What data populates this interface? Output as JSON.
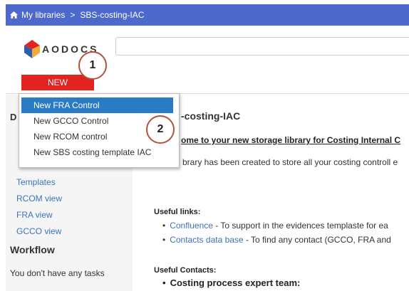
{
  "breadcrumb": {
    "home_label": "My libraries",
    "separator": ">",
    "current": "SBS-costing-IAC"
  },
  "header": {
    "logo_text": "AODOCS",
    "new_button": "NEW"
  },
  "callouts": [
    "1",
    "2"
  ],
  "new_menu": {
    "items": [
      "New FRA Control",
      "New GCCO Control",
      "New RCOM control",
      "New SBS costing template IAC"
    ],
    "active_index": 0
  },
  "sidebar": {
    "partial_heading": "D",
    "links": [
      "Templates",
      "RCOM view",
      "FRA view",
      "GCCO view"
    ],
    "workflow_heading": "Workflow",
    "workflow_note": "You don't have any tasks"
  },
  "main": {
    "title_partial": "-costing-IAC",
    "welcome_partial": "ome to your new storage library for Costing Internal C",
    "description_partial": "brary has been created to store all your costing controll e",
    "useful_links_title": "Useful links:",
    "useful_links": [
      {
        "link": "Confluence",
        "text": " - To support in the evidences templaste for ea"
      },
      {
        "link": "Contacts data base",
        "text": " - To find any contact (GCCO, FRA and"
      }
    ],
    "useful_contacts_title": "Useful Contacts:",
    "expert_team": "Costing process expert team:"
  },
  "colors": {
    "topbar": "#4d69cb",
    "new_button": "#e3231f",
    "menu_highlight": "#2a7bc5",
    "link": "#3b73b9",
    "callout_border": "#b4513c"
  }
}
